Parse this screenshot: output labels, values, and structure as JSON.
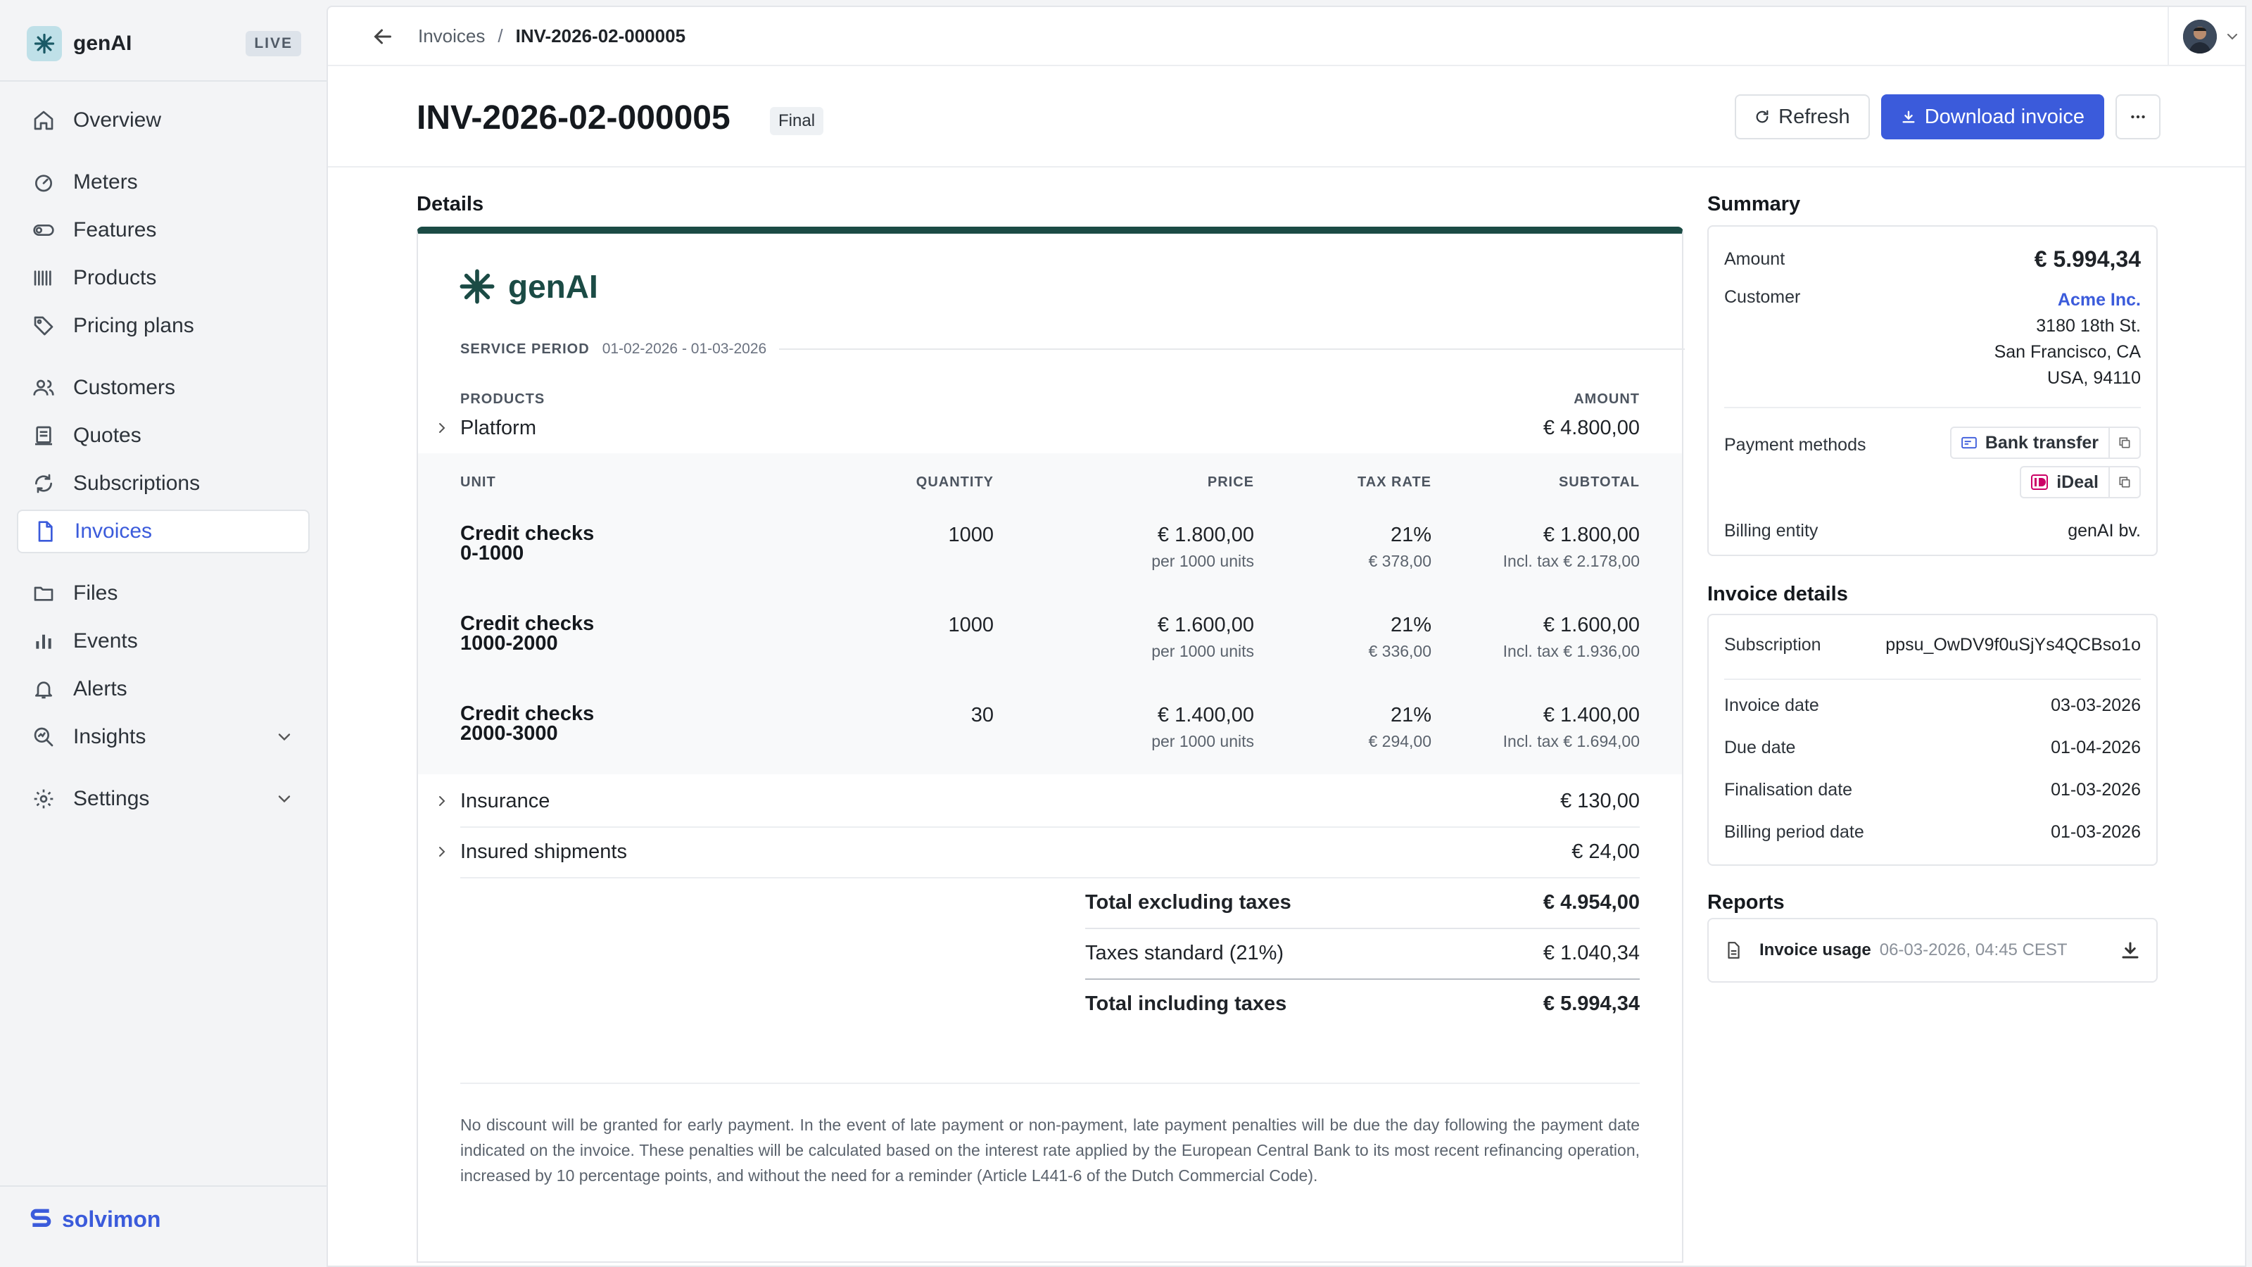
{
  "sidebar": {
    "brand": "genAI",
    "env_badge": "LIVE",
    "items": [
      {
        "label": "Overview"
      },
      {
        "label": "Meters"
      },
      {
        "label": "Features"
      },
      {
        "label": "Products"
      },
      {
        "label": "Pricing plans"
      },
      {
        "label": "Customers"
      },
      {
        "label": "Quotes"
      },
      {
        "label": "Subscriptions"
      },
      {
        "label": "Invoices"
      },
      {
        "label": "Files"
      },
      {
        "label": "Events"
      },
      {
        "label": "Alerts"
      },
      {
        "label": "Insights"
      },
      {
        "label": "Settings"
      }
    ],
    "footer_logo": "solvimon"
  },
  "breadcrumb": {
    "parent": "Invoices",
    "separator": "/",
    "current": "INV-2026-02-000005"
  },
  "header": {
    "title": "INV-2026-02-000005",
    "status": "Final",
    "refresh_label": "Refresh",
    "download_label": "Download invoice",
    "more_label": "···"
  },
  "details": {
    "section_title": "Details",
    "logo_text": "genAI",
    "service_period_label": "SERVICE PERIOD",
    "service_period_value": "01-02-2026 - 01-03-2026",
    "products_header": "PRODUCTS",
    "amount_header": "AMOUNT",
    "unit_headers": {
      "unit": "UNIT",
      "quantity": "QUANTITY",
      "price": "PRICE",
      "tax_rate": "TAX RATE",
      "subtotal": "SUBTOTAL"
    },
    "products": [
      {
        "name": "Platform",
        "amount": "€ 4.800,00"
      },
      {
        "name": "Insurance",
        "amount": "€ 130,00"
      },
      {
        "name": "Insured shipments",
        "amount": "€ 24,00"
      }
    ],
    "units": [
      {
        "name_line1": "Credit checks",
        "name_line2": "0-1000",
        "quantity": "1000",
        "price": "€ 1.800,00",
        "price_unit": "per 1000 units",
        "tax_rate": "21%",
        "tax_amount": "€ 378,00",
        "subtotal": "€ 1.800,00",
        "subtotal_incl": "Incl. tax € 2.178,00"
      },
      {
        "name_line1": "Credit checks",
        "name_line2": "1000-2000",
        "quantity": "1000",
        "price": "€ 1.600,00",
        "price_unit": "per 1000 units",
        "tax_rate": "21%",
        "tax_amount": "€ 336,00",
        "subtotal": "€ 1.600,00",
        "subtotal_incl": "Incl. tax € 1.936,00"
      },
      {
        "name_line1": "Credit checks",
        "name_line2": "2000-3000",
        "quantity": "30",
        "price": "€ 1.400,00",
        "price_unit": "per 1000 units",
        "tax_rate": "21%",
        "tax_amount": "€ 294,00",
        "subtotal": "€ 1.400,00",
        "subtotal_incl": "Incl. tax € 1.694,00"
      }
    ],
    "totals": {
      "excl_label": "Total excluding taxes",
      "excl_value": "€ 4.954,00",
      "tax_label": "Taxes standard (21%)",
      "tax_value": "€ 1.040,34",
      "incl_label": "Total including taxes",
      "incl_value": "€ 5.994,34"
    },
    "footnote": "No discount will be granted for early payment. In the event of late payment or non-payment, late payment penalties will be due the day following the payment date indicated on the invoice. These penalties will be calculated based on the interest rate applied by the European Central Bank to its most recent refinancing operation, increased by 10 percentage points, and without the need for a reminder (Article L441-6 of the Dutch Commercial Code)."
  },
  "summary": {
    "section_title": "Summary",
    "amount_label": "Amount",
    "amount_value": "€ 5.994,34",
    "customer_label": "Customer",
    "customer_name": "Acme Inc.",
    "address_line1": "3180 18th St.",
    "address_line2": "San Francisco, CA",
    "address_line3": "USA, 94110",
    "payment_methods_label": "Payment methods",
    "payment_methods": [
      "Bank transfer",
      "iDeal"
    ],
    "billing_entity_label": "Billing entity",
    "billing_entity_value": "genAI bv."
  },
  "invoice_details": {
    "section_title": "Invoice details",
    "subscription_label": "Subscription",
    "subscription_value": "ppsu_OwDV9f0uSjYs4QCBso1o",
    "invoice_date_label": "Invoice date",
    "invoice_date_value": "03-03-2026",
    "due_date_label": "Due date",
    "due_date_value": "01-04-2026",
    "finalisation_date_label": "Finalisation date",
    "finalisation_date_value": "01-03-2026",
    "billing_period_date_label": "Billing period date",
    "billing_period_date_value": "01-03-2026"
  },
  "reports": {
    "section_title": "Reports",
    "items": [
      {
        "name": "Invoice usage",
        "date": "06-03-2026, 04:45 CEST"
      }
    ]
  },
  "colors": {
    "accent": "#3b5bdb",
    "invoice_brand": "#1b4b45",
    "sidebar_bg": "#f3f4f6"
  }
}
